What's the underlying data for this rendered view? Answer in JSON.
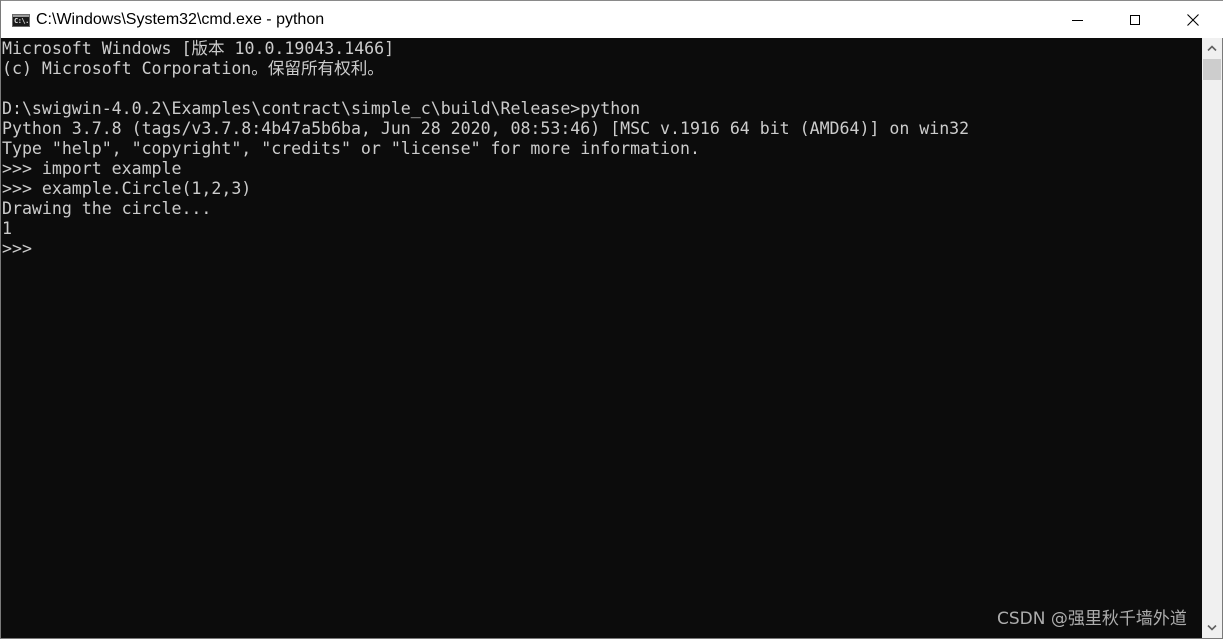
{
  "window": {
    "title": "C:\\Windows\\System32\\cmd.exe - python",
    "icon_label": "C:\\.",
    "controls": {
      "minimize": "minimize",
      "maximize": "maximize",
      "close": "close"
    }
  },
  "console": {
    "lines": [
      "Microsoft Windows [版本 10.0.19043.1466]",
      "(c) Microsoft Corporation。保留所有权利。",
      "",
      "D:\\swigwin-4.0.2\\Examples\\contract\\simple_c\\build\\Release>python",
      "Python 3.7.8 (tags/v3.7.8:4b47a5b6ba, Jun 28 2020, 08:53:46) [MSC v.1916 64 bit (AMD64)] on win32",
      "Type \"help\", \"copyright\", \"credits\" or \"license\" for more information.",
      ">>> import example",
      ">>> example.Circle(1,2,3)",
      "Drawing the circle...",
      "1",
      ">>> "
    ],
    "foreground_color": "#cccccc",
    "background_color": "#0c0c0c"
  },
  "scrollbar": {
    "up_icon": "chevron-up-icon",
    "down_icon": "chevron-down-icon"
  },
  "watermark": "CSDN @强里秋千墙外道"
}
